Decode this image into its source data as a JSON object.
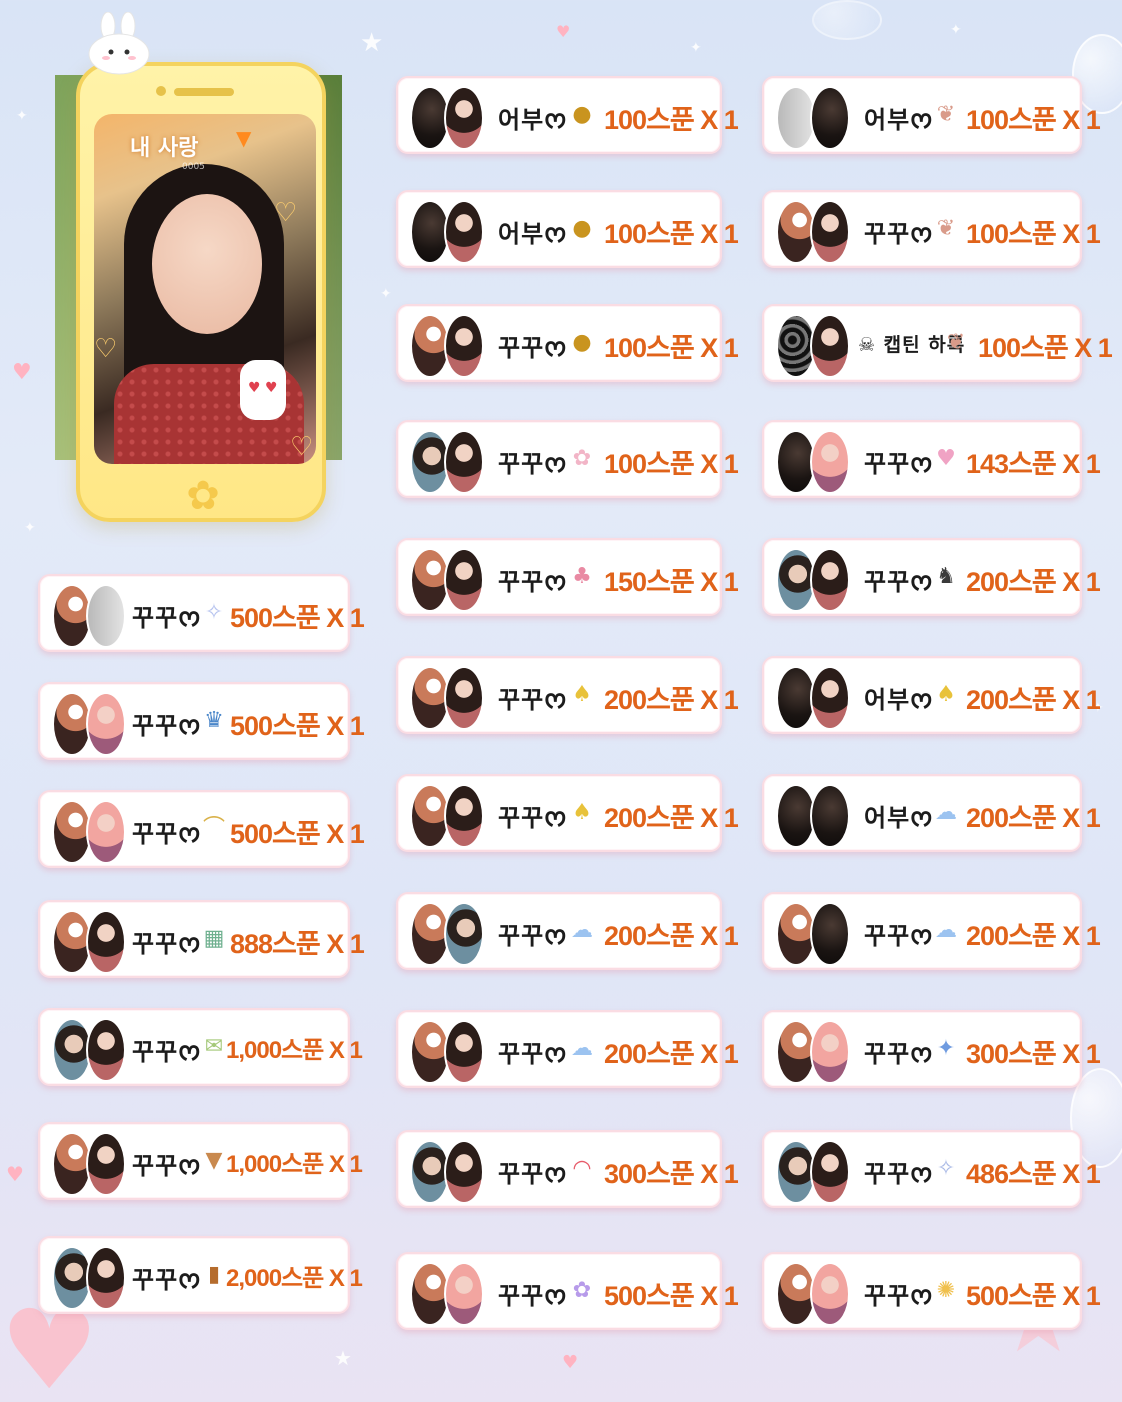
{
  "phone": {
    "title": "내 사랑",
    "subtitle": "0005"
  },
  "cards": [
    {
      "nickname": "어부ᰔ",
      "amount": "100스푼 X 1",
      "gift_icon": "bowl-icon",
      "glyph": "●",
      "color": "#c9941f",
      "avatars": [
        "av-dark",
        "av-girl"
      ]
    },
    {
      "nickname": "어부ᰔ",
      "amount": "100스푼 X 1",
      "gift_icon": "bowl-icon",
      "glyph": "●",
      "color": "#c9941f",
      "avatars": [
        "av-dark",
        "av-girl"
      ]
    },
    {
      "nickname": "꾸꾸ᰔ",
      "amount": "100스푼 X 1",
      "gift_icon": "bowl-icon",
      "glyph": "●",
      "color": "#c9941f",
      "avatars": [
        "av-glow",
        "av-girl"
      ]
    },
    {
      "nickname": "꾸꾸ᰔ",
      "amount": "100스푼 X 1",
      "gift_icon": "bunny-icon",
      "glyph": "✿",
      "color": "#f2b5c7",
      "avatars": [
        "av-boy",
        "av-girl"
      ]
    },
    {
      "nickname": "꾸꾸ᰔ",
      "amount": "150스푼 X 1",
      "gift_icon": "cake-icon",
      "glyph": "♣",
      "color": "#e98aa3",
      "avatars": [
        "av-glow",
        "av-girl"
      ]
    },
    {
      "nickname": "꾸꾸ᰔ",
      "amount": "200스푼 X 1",
      "gift_icon": "pineapple-icon",
      "glyph": "♠",
      "color": "#e8c23a",
      "avatars": [
        "av-glow",
        "av-girl"
      ]
    },
    {
      "nickname": "꾸꾸ᰔ",
      "amount": "200스푼 X 1",
      "gift_icon": "pineapple-icon",
      "glyph": "♠",
      "color": "#e8c23a",
      "avatars": [
        "av-glow",
        "av-girl"
      ]
    },
    {
      "nickname": "꾸꾸ᰔ",
      "amount": "200스푼 X 1",
      "gift_icon": "cloud-icon",
      "glyph": "☁",
      "color": "#9cc3f0",
      "avatars": [
        "av-glow",
        "av-boy"
      ]
    },
    {
      "nickname": "꾸꾸ᰔ",
      "amount": "200스푼 X 1",
      "gift_icon": "cloud-icon",
      "glyph": "☁",
      "color": "#9cc3f0",
      "avatars": [
        "av-glow",
        "av-girl"
      ]
    },
    {
      "nickname": "꾸꾸ᰔ",
      "amount": "300스푼 X 1",
      "gift_icon": "gauge-icon",
      "glyph": "◠",
      "color": "#e75b6a",
      "avatars": [
        "av-boy",
        "av-girl"
      ]
    },
    {
      "nickname": "꾸꾸ᰔ",
      "amount": "500스푼 X 1",
      "gift_icon": "flower-icon",
      "glyph": "✿",
      "color": "#b79bea",
      "avatars": [
        "av-glow",
        "av-pink"
      ]
    },
    {
      "nickname": "어부ᰔ",
      "amount": "100스푼 X 1",
      "gift_icon": "candy-icon",
      "glyph": "❦",
      "color": "#d99b8a",
      "avatars": [
        "av-grey",
        "av-dark"
      ]
    },
    {
      "nickname": "꾸꾸ᰔ",
      "amount": "100스푼 X 1",
      "gift_icon": "candy-icon",
      "glyph": "❦",
      "color": "#d99b8a",
      "avatars": [
        "av-glow",
        "av-girl"
      ]
    },
    {
      "nickname": "☠ 캡틴 하록",
      "amount": "100스푼 X 1",
      "gift_icon": "candy-icon",
      "glyph": "❦",
      "color": "#d99b8a",
      "avatars": [
        "av-mono",
        "av-girl"
      ]
    },
    {
      "nickname": "꾸꾸ᰔ",
      "amount": "143스푼 X 1",
      "gift_icon": "heart-gift-icon",
      "glyph": "♥",
      "color": "#f0a3c4",
      "avatars": [
        "av-dark",
        "av-pink"
      ]
    },
    {
      "nickname": "꾸꾸ᰔ",
      "amount": "200스푼 X 1",
      "gift_icon": "cow-icon",
      "glyph": "♞",
      "color": "#3a3a3a",
      "avatars": [
        "av-boy",
        "av-girl"
      ]
    },
    {
      "nickname": "어부ᰔ",
      "amount": "200스푼 X 1",
      "gift_icon": "pineapple-icon",
      "glyph": "♠",
      "color": "#e8c23a",
      "avatars": [
        "av-dark",
        "av-girl"
      ]
    },
    {
      "nickname": "어부ᰔ",
      "amount": "200스푼 X 1",
      "gift_icon": "cloud-icon",
      "glyph": "☁",
      "color": "#9cc3f0",
      "avatars": [
        "av-dark",
        "av-dark"
      ]
    },
    {
      "nickname": "꾸꾸ᰔ",
      "amount": "200스푼 X 1",
      "gift_icon": "cloud-icon",
      "glyph": "☁",
      "color": "#9cc3f0",
      "avatars": [
        "av-glow",
        "av-dark"
      ]
    },
    {
      "nickname": "꾸꾸ᰔ",
      "amount": "300스푼 X 1",
      "gift_icon": "spinner-icon",
      "glyph": "✦",
      "color": "#6f9be0",
      "avatars": [
        "av-glow",
        "av-pink"
      ]
    },
    {
      "nickname": "꾸꾸ᰔ",
      "amount": "486스푼 X 1",
      "gift_icon": "stars-icon",
      "glyph": "✧",
      "color": "#a9b9e6",
      "avatars": [
        "av-boy",
        "av-girl"
      ]
    },
    {
      "nickname": "꾸꾸ᰔ",
      "amount": "500스푼 X 1",
      "gift_icon": "sparkle-gift-icon",
      "glyph": "✺",
      "color": "#f0c04d",
      "avatars": [
        "av-glow",
        "av-pink"
      ]
    },
    {
      "nickname": "꾸꾸ᰔ",
      "amount": "500스푼 X 1",
      "gift_icon": "sparkle-gift-icon",
      "glyph": "✧",
      "color": "#b6c3ef",
      "avatars": [
        "av-glow",
        "av-grey"
      ]
    },
    {
      "nickname": "꾸꾸ᰔ",
      "amount": "500스푼 X 1",
      "gift_icon": "frame-icon",
      "glyph": "♛",
      "color": "#4a86c9",
      "avatars": [
        "av-glow",
        "av-pink"
      ]
    },
    {
      "nickname": "꾸꾸ᰔ",
      "amount": "500스푼 X 1",
      "gift_icon": "arch-icon",
      "glyph": "⌒",
      "color": "#d9b24a",
      "avatars": [
        "av-glow",
        "av-pink"
      ]
    },
    {
      "nickname": "꾸꾸ᰔ",
      "amount": "888스푼 X 1",
      "gift_icon": "map-icon",
      "glyph": "▦",
      "color": "#6fb08f",
      "avatars": [
        "av-glow",
        "av-girl"
      ]
    },
    {
      "nickname": "꾸꾸ᰔ",
      "amount": "1,000스푼 X 1",
      "gift_icon": "envelope-icon",
      "glyph": "✉",
      "color": "#a4c879",
      "avatars": [
        "av-boy",
        "av-girl"
      ]
    },
    {
      "nickname": "꾸꾸ᰔ",
      "amount": "1,000스푼 X 1",
      "gift_icon": "icecream-icon",
      "glyph": "▼",
      "color": "#c9894e",
      "avatars": [
        "av-glow",
        "av-girl"
      ]
    },
    {
      "nickname": "꾸꾸ᰔ",
      "amount": "2,000스푼 X 1",
      "gift_icon": "drink-icon",
      "glyph": "▮",
      "color": "#b56c2d",
      "avatars": [
        "av-boy",
        "av-girl"
      ]
    }
  ]
}
